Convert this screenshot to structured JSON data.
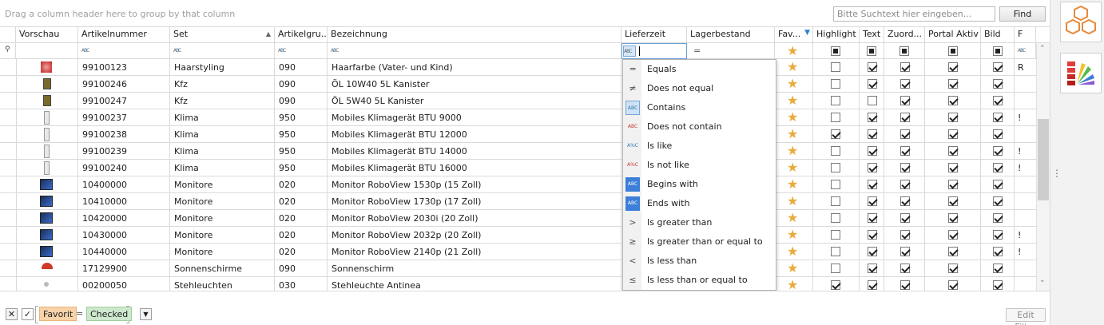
{
  "group_bar": {
    "hint": "Drag a column header here to group by that column"
  },
  "search": {
    "placeholder": "Bitte Suchtext hier eingeben...",
    "find_label": "Find"
  },
  "columns": {
    "vorschau": "Vorschau",
    "artikelnummer": "Artikelnummer",
    "set": "Set",
    "artikelgruppe": "Artikelgru...",
    "bezeichnung": "Bezeichnung",
    "lieferzeit": "Lieferzeit",
    "lagerbestand": "Lagerbestand",
    "favorit": "Fav...",
    "highlight": "Highlight",
    "text": "Text",
    "zuordnung": "Zuord...",
    "portal_aktiv": "Portal Aktiv",
    "bild": "Bild",
    "f": "F"
  },
  "rows": [
    {
      "artnr": "99100123",
      "set": "Haarstyling",
      "gruppe": "090",
      "bez": "Haarfarbe (Vater- und Kind)",
      "highlight": false,
      "text": true,
      "zuord": true,
      "portal": true,
      "bild": true,
      "f": "R"
    },
    {
      "artnr": "99100246",
      "set": "Kfz",
      "gruppe": "090",
      "bez": "ÖL 10W40 5L Kanister",
      "highlight": false,
      "text": true,
      "zuord": true,
      "portal": true,
      "bild": true,
      "f": ""
    },
    {
      "artnr": "99100247",
      "set": "Kfz",
      "gruppe": "090",
      "bez": "ÖL 5W40 5L Kanister",
      "highlight": false,
      "text": false,
      "zuord": true,
      "portal": true,
      "bild": true,
      "f": ""
    },
    {
      "artnr": "99100237",
      "set": "Klima",
      "gruppe": "950",
      "bez": "Mobiles Klimagerät BTU 9000",
      "highlight": false,
      "text": true,
      "zuord": true,
      "portal": true,
      "bild": true,
      "f": "!"
    },
    {
      "artnr": "99100238",
      "set": "Klima",
      "gruppe": "950",
      "bez": "Mobiles Klimagerät BTU 12000",
      "highlight": true,
      "text": true,
      "zuord": true,
      "portal": true,
      "bild": true,
      "f": ""
    },
    {
      "artnr": "99100239",
      "set": "Klima",
      "gruppe": "950",
      "bez": "Mobiles Klimagerät BTU 14000",
      "highlight": false,
      "text": true,
      "zuord": true,
      "portal": true,
      "bild": true,
      "f": "!"
    },
    {
      "artnr": "99100240",
      "set": "Klima",
      "gruppe": "950",
      "bez": "Mobiles Klimagerät BTU 16000",
      "highlight": false,
      "text": true,
      "zuord": true,
      "portal": true,
      "bild": true,
      "f": "!"
    },
    {
      "artnr": "10400000",
      "set": "Monitore",
      "gruppe": "020",
      "bez": "Monitor RoboView 1530p (15 Zoll)",
      "highlight": false,
      "text": true,
      "zuord": true,
      "portal": true,
      "bild": true,
      "f": ""
    },
    {
      "artnr": "10410000",
      "set": "Monitore",
      "gruppe": "020",
      "bez": "Monitor RoboView 1730p (17 Zoll)",
      "highlight": false,
      "text": true,
      "zuord": true,
      "portal": true,
      "bild": true,
      "f": ""
    },
    {
      "artnr": "10420000",
      "set": "Monitore",
      "gruppe": "020",
      "bez": "Monitor RoboView 2030i (20 Zoll)",
      "highlight": false,
      "text": true,
      "zuord": true,
      "portal": true,
      "bild": true,
      "f": ""
    },
    {
      "artnr": "10430000",
      "set": "Monitore",
      "gruppe": "020",
      "bez": "Monitor RoboView 2032p (20 Zoll)",
      "highlight": false,
      "text": true,
      "zuord": true,
      "portal": true,
      "bild": true,
      "f": "!"
    },
    {
      "artnr": "10440000",
      "set": "Monitore",
      "gruppe": "020",
      "bez": "Monitor RoboView 2140p (21 Zoll)",
      "highlight": false,
      "text": true,
      "zuord": true,
      "portal": true,
      "bild": true,
      "f": "!"
    },
    {
      "artnr": "17129900",
      "set": "Sonnenschirme",
      "gruppe": "090",
      "bez": "Sonnenschirm",
      "highlight": false,
      "text": true,
      "zuord": true,
      "portal": true,
      "bild": true,
      "f": ""
    },
    {
      "artnr": "00200050",
      "set": "Stehleuchten",
      "gruppe": "030",
      "bez": "Stehleuchte Antinea",
      "highlight": true,
      "text": true,
      "zuord": true,
      "portal": true,
      "bild": true,
      "f": ""
    }
  ],
  "operator_menu": [
    {
      "icon": "equals-icon",
      "glyph": "═",
      "label": "Equals"
    },
    {
      "icon": "not-equal-icon",
      "glyph": "≠",
      "label": "Does not equal"
    },
    {
      "icon": "contains-icon",
      "glyph": "ABC",
      "label": "Contains"
    },
    {
      "icon": "not-contain-icon",
      "glyph": "ABC",
      "label": "Does not contain"
    },
    {
      "icon": "like-icon",
      "glyph": "A%C",
      "label": "Is like"
    },
    {
      "icon": "not-like-icon",
      "glyph": "A%C",
      "label": "Is not like"
    },
    {
      "icon": "begins-with-icon",
      "glyph": "ABC",
      "label": "Begins with"
    },
    {
      "icon": "ends-with-icon",
      "glyph": "ABC",
      "label": "Ends with"
    },
    {
      "icon": "greater-icon",
      "glyph": ">",
      "label": "Is greater than"
    },
    {
      "icon": "greater-equal-icon",
      "glyph": "≥",
      "label": "Is greater than or equal to"
    },
    {
      "icon": "less-icon",
      "glyph": "<",
      "label": "Is less than"
    },
    {
      "icon": "less-equal-icon",
      "glyph": "≤",
      "label": "Is less than or equal to"
    }
  ],
  "filter_panel": {
    "field": "Favorit",
    "op": "=",
    "value": "Checked",
    "edit_label": "Edit Filter"
  },
  "colors": {
    "star": "#e8ac3c",
    "field_pill": "#f8d3a8",
    "value_pill": "#cde8cd",
    "selected_menu": "#cfe2f5"
  }
}
